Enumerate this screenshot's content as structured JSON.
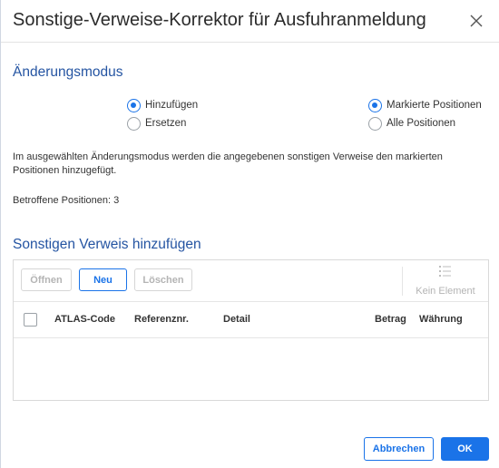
{
  "dialog": {
    "title": "Sonstige-Verweise-Korrektor für Ausfuhranmeldung",
    "close_icon": "close-icon"
  },
  "mode": {
    "heading": "Änderungsmodus",
    "options_left": [
      {
        "label": "Hinzufügen",
        "checked": true
      },
      {
        "label": "Ersetzen",
        "checked": false
      }
    ],
    "options_right": [
      {
        "label": "Markierte Positionen",
        "checked": true
      },
      {
        "label": "Alle Positionen",
        "checked": false
      }
    ],
    "description": "Im ausgewählten Änderungsmodus werden die angegebenen sonstigen Verweise den markierten Positionen hinzugefügt.",
    "affected": "Betroffene Positionen: 3"
  },
  "references": {
    "heading": "Sonstigen Verweis hinzufügen",
    "toolbar": {
      "open_label": "Öffnen",
      "new_label": "Neu",
      "delete_label": "Löschen",
      "no_element_label": "Kein Element",
      "no_element_icon": "list-icon"
    },
    "columns": [
      "ATLAS-Code",
      "Referenznr.",
      "Detail",
      "Betrag",
      "Währung"
    ],
    "rows": []
  },
  "footer": {
    "cancel_label": "Abbrechen",
    "ok_label": "OK"
  },
  "colors": {
    "accent": "#1a73e8",
    "heading": "#2454a2"
  }
}
